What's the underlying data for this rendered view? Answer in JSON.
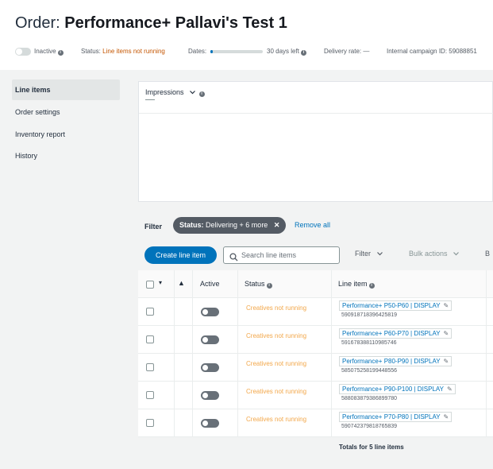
{
  "order": {
    "prefix": "Order:",
    "name": "Performance+ Pallavi's Test 1"
  },
  "meta": {
    "toggle_label": "Inactive",
    "status_label": "Status:",
    "status_value": "Line items not running",
    "dates_label": "Dates:",
    "dates_progress": 0.04,
    "days_left": "30 days left",
    "delivery_rate": "Delivery rate: —",
    "campaign_id": "Internal campaign ID: 59088851"
  },
  "info_glyph": "i",
  "sidebar": {
    "items": [
      {
        "label": "Line items",
        "active": true
      },
      {
        "label": "Order settings"
      },
      {
        "label": "Inventory report"
      },
      {
        "label": "History"
      }
    ]
  },
  "chart": {
    "metric": "Impressions",
    "value": ""
  },
  "filter": {
    "label": "Filter",
    "chip_key": "Status:",
    "chip_value": "Delivering + 6 more",
    "chip_close": "✕",
    "remove_all": "Remove all"
  },
  "actions": {
    "create": "Create line item",
    "search_placeholder": "Search line items",
    "filter": "Filter",
    "bulk": "Bulk actions",
    "overflow": "B"
  },
  "table": {
    "headers": {
      "active": "Active",
      "status": "Status",
      "line_item": "Line item",
      "warning_glyph": "▲",
      "caret_glyph": "▾"
    },
    "rows": [
      {
        "status": "Creatives not running",
        "name": "Performance+ P50-P60 | DISPLAY",
        "id": "590918718396425819"
      },
      {
        "status": "Creatives not running",
        "name": "Performance+ P60-P70 | DISPLAY",
        "id": "591678388110985746"
      },
      {
        "status": "Creatives not running",
        "name": "Performance+ P80-P90 | DISPLAY",
        "id": "585075258199448556"
      },
      {
        "status": "Creatives not running",
        "name": "Performance+ P90-P100 | DISPLAY",
        "id": "588083879386899780"
      },
      {
        "status": "Creatives not running",
        "name": "Performance+ P70-P80 | DISPLAY",
        "id": "590742379818765839"
      }
    ],
    "totals": "Totals for 5 line items",
    "edit_glyph": "✎"
  },
  "colors": {
    "primary": "#0073bb",
    "status_warning": "#f2a74a",
    "status_orange": "#c45500",
    "chip_bg": "#545b64",
    "page_bg": "#f2f3f3"
  }
}
